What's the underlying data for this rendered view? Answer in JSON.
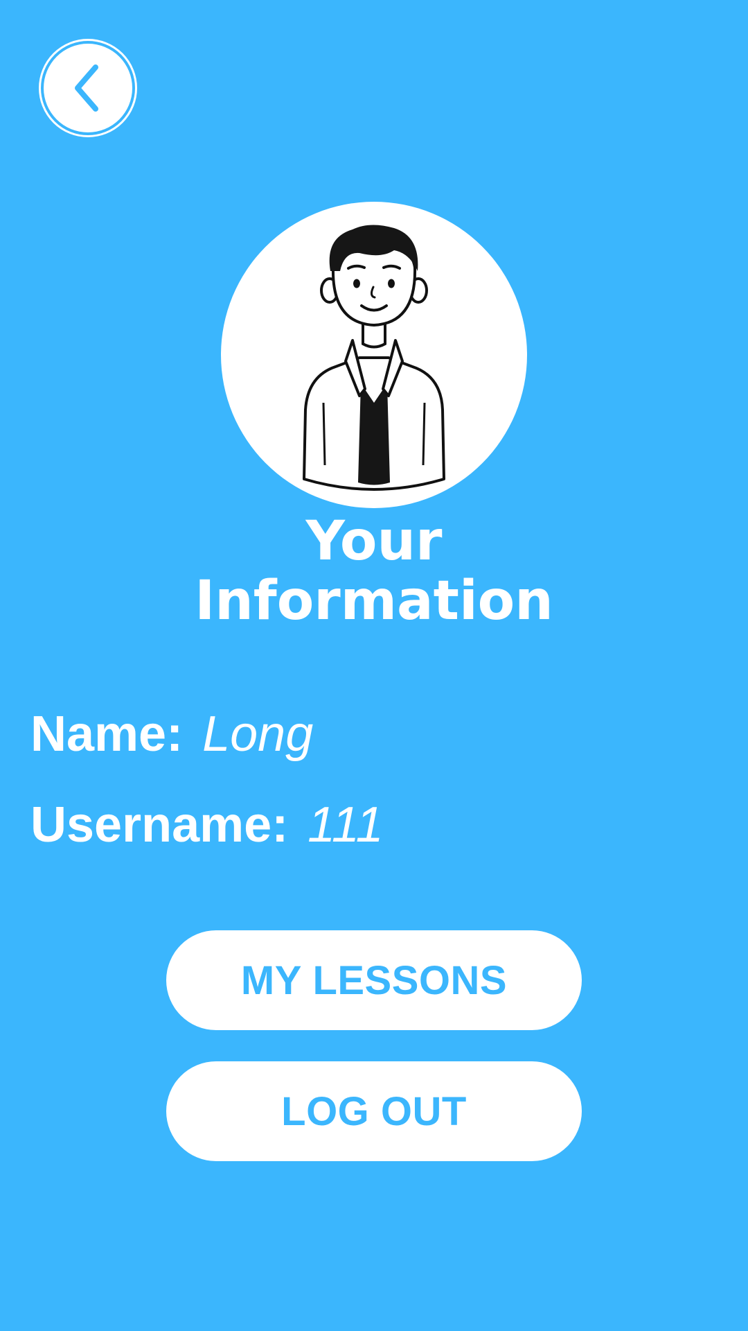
{
  "header": {
    "back_icon": "chevron-left-icon"
  },
  "profile": {
    "avatar_icon": "user-avatar-illustration",
    "title_line1": "Your",
    "title_line2": "Information"
  },
  "info": {
    "name_label": "Name:",
    "name_value": "Long",
    "username_label": "Username:",
    "username_value": "111"
  },
  "actions": {
    "my_lessons_label": "MY LESSONS",
    "log_out_label": "LOG OUT"
  },
  "colors": {
    "background": "#3bb6fd",
    "button_bg": "#ffffff",
    "button_text": "#3bb6fd",
    "text": "#ffffff"
  }
}
